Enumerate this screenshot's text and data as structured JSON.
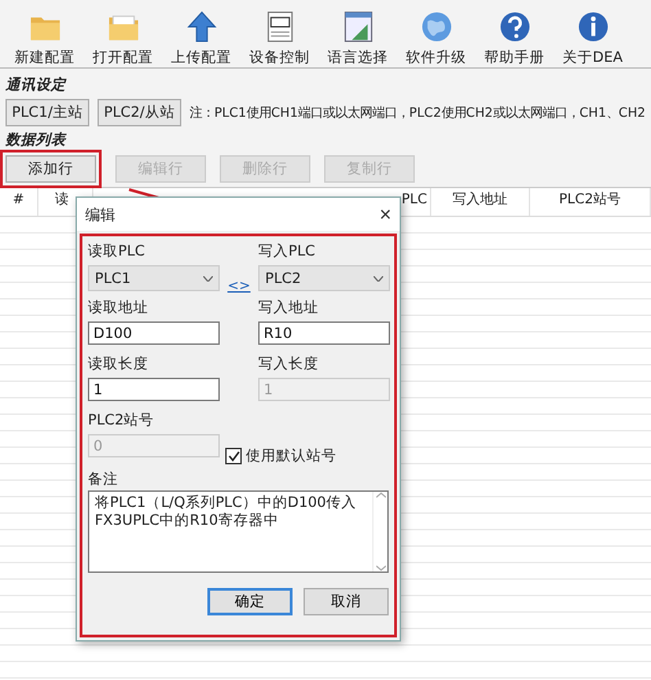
{
  "toolbar": [
    {
      "label": "新建配置",
      "kind": "folder"
    },
    {
      "label": "打开配置",
      "kind": "open"
    },
    {
      "label": "上传配置",
      "kind": "upload"
    },
    {
      "label": "设备控制",
      "kind": "device"
    },
    {
      "label": "语言选择",
      "kind": "window"
    },
    {
      "label": "软件升级",
      "kind": "globe"
    },
    {
      "label": "帮助手册",
      "kind": "help"
    },
    {
      "label": "关于DEA",
      "kind": "info"
    }
  ],
  "comm_settings": {
    "title": "通讯设定",
    "buttons": [
      "PLC1/主站",
      "PLC2/从站"
    ],
    "note": "注：PLC1使用CH1端口或以太网端口，PLC2使用CH2或以太网端口，CH1、CH2"
  },
  "data_list": {
    "title": "数据列表",
    "buttons": [
      {
        "label": "添加行",
        "disabled": false,
        "highlighted": true
      },
      {
        "label": "编辑行",
        "disabled": true,
        "highlighted": false
      },
      {
        "label": "删除行",
        "disabled": true,
        "highlighted": false
      },
      {
        "label": "复制行",
        "disabled": true,
        "highlighted": false
      }
    ]
  },
  "table": {
    "columns": [
      "#",
      "读",
      "PLC",
      "写入地址",
      "PLC2站号"
    ]
  },
  "dialog": {
    "title": "编辑",
    "close": "×",
    "read_plc": {
      "label": "读取PLC",
      "value": "PLC1"
    },
    "swap": "<>",
    "write_plc": {
      "label": "写入PLC",
      "value": "PLC2"
    },
    "read_address": {
      "label": "读取地址",
      "value": "D100",
      "disabled": false
    },
    "write_address": {
      "label": "写入地址",
      "value": "R10",
      "disabled": false
    },
    "read_length": {
      "label": "读取长度",
      "value": "1",
      "disabled": false
    },
    "write_length": {
      "label": "写入长度",
      "value": "1",
      "disabled": true
    },
    "plc2_station": {
      "label": "PLC2站号",
      "value": "0",
      "disabled": true
    },
    "use_default_station": {
      "label": "使用默认站号",
      "checked": true
    },
    "remark": {
      "label": "备注",
      "value": "将PLC1（L/Q系列PLC）中的D100传入FX3UPLC中的R10寄存器中"
    },
    "buttons": [
      {
        "label": "确定",
        "focused": true
      },
      {
        "label": "取消",
        "focused": false
      }
    ]
  }
}
